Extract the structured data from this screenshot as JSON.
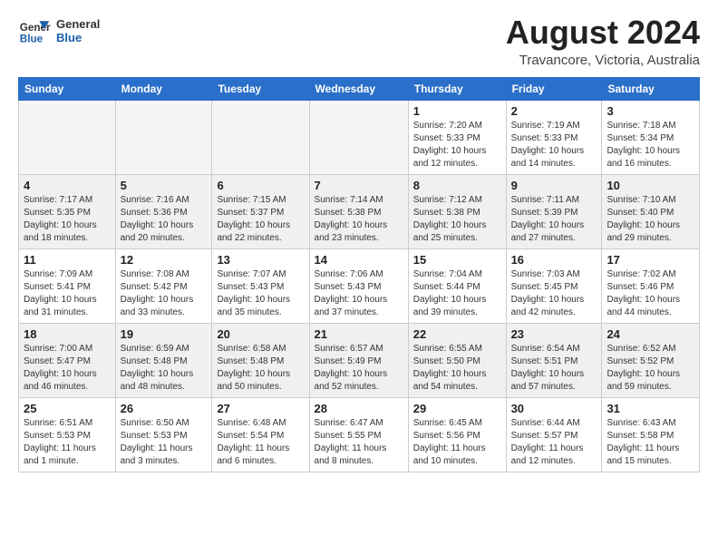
{
  "header": {
    "logo_general": "General",
    "logo_blue": "Blue",
    "month_title": "August 2024",
    "subtitle": "Travancore, Victoria, Australia"
  },
  "days_of_week": [
    "Sunday",
    "Monday",
    "Tuesday",
    "Wednesday",
    "Thursday",
    "Friday",
    "Saturday"
  ],
  "weeks": [
    [
      {
        "day": "",
        "info": ""
      },
      {
        "day": "",
        "info": ""
      },
      {
        "day": "",
        "info": ""
      },
      {
        "day": "",
        "info": ""
      },
      {
        "day": "1",
        "info": "Sunrise: 7:20 AM\nSunset: 5:33 PM\nDaylight: 10 hours\nand 12 minutes."
      },
      {
        "day": "2",
        "info": "Sunrise: 7:19 AM\nSunset: 5:33 PM\nDaylight: 10 hours\nand 14 minutes."
      },
      {
        "day": "3",
        "info": "Sunrise: 7:18 AM\nSunset: 5:34 PM\nDaylight: 10 hours\nand 16 minutes."
      }
    ],
    [
      {
        "day": "4",
        "info": "Sunrise: 7:17 AM\nSunset: 5:35 PM\nDaylight: 10 hours\nand 18 minutes."
      },
      {
        "day": "5",
        "info": "Sunrise: 7:16 AM\nSunset: 5:36 PM\nDaylight: 10 hours\nand 20 minutes."
      },
      {
        "day": "6",
        "info": "Sunrise: 7:15 AM\nSunset: 5:37 PM\nDaylight: 10 hours\nand 22 minutes."
      },
      {
        "day": "7",
        "info": "Sunrise: 7:14 AM\nSunset: 5:38 PM\nDaylight: 10 hours\nand 23 minutes."
      },
      {
        "day": "8",
        "info": "Sunrise: 7:12 AM\nSunset: 5:38 PM\nDaylight: 10 hours\nand 25 minutes."
      },
      {
        "day": "9",
        "info": "Sunrise: 7:11 AM\nSunset: 5:39 PM\nDaylight: 10 hours\nand 27 minutes."
      },
      {
        "day": "10",
        "info": "Sunrise: 7:10 AM\nSunset: 5:40 PM\nDaylight: 10 hours\nand 29 minutes."
      }
    ],
    [
      {
        "day": "11",
        "info": "Sunrise: 7:09 AM\nSunset: 5:41 PM\nDaylight: 10 hours\nand 31 minutes."
      },
      {
        "day": "12",
        "info": "Sunrise: 7:08 AM\nSunset: 5:42 PM\nDaylight: 10 hours\nand 33 minutes."
      },
      {
        "day": "13",
        "info": "Sunrise: 7:07 AM\nSunset: 5:43 PM\nDaylight: 10 hours\nand 35 minutes."
      },
      {
        "day": "14",
        "info": "Sunrise: 7:06 AM\nSunset: 5:43 PM\nDaylight: 10 hours\nand 37 minutes."
      },
      {
        "day": "15",
        "info": "Sunrise: 7:04 AM\nSunset: 5:44 PM\nDaylight: 10 hours\nand 39 minutes."
      },
      {
        "day": "16",
        "info": "Sunrise: 7:03 AM\nSunset: 5:45 PM\nDaylight: 10 hours\nand 42 minutes."
      },
      {
        "day": "17",
        "info": "Sunrise: 7:02 AM\nSunset: 5:46 PM\nDaylight: 10 hours\nand 44 minutes."
      }
    ],
    [
      {
        "day": "18",
        "info": "Sunrise: 7:00 AM\nSunset: 5:47 PM\nDaylight: 10 hours\nand 46 minutes."
      },
      {
        "day": "19",
        "info": "Sunrise: 6:59 AM\nSunset: 5:48 PM\nDaylight: 10 hours\nand 48 minutes."
      },
      {
        "day": "20",
        "info": "Sunrise: 6:58 AM\nSunset: 5:48 PM\nDaylight: 10 hours\nand 50 minutes."
      },
      {
        "day": "21",
        "info": "Sunrise: 6:57 AM\nSunset: 5:49 PM\nDaylight: 10 hours\nand 52 minutes."
      },
      {
        "day": "22",
        "info": "Sunrise: 6:55 AM\nSunset: 5:50 PM\nDaylight: 10 hours\nand 54 minutes."
      },
      {
        "day": "23",
        "info": "Sunrise: 6:54 AM\nSunset: 5:51 PM\nDaylight: 10 hours\nand 57 minutes."
      },
      {
        "day": "24",
        "info": "Sunrise: 6:52 AM\nSunset: 5:52 PM\nDaylight: 10 hours\nand 59 minutes."
      }
    ],
    [
      {
        "day": "25",
        "info": "Sunrise: 6:51 AM\nSunset: 5:53 PM\nDaylight: 11 hours\nand 1 minute."
      },
      {
        "day": "26",
        "info": "Sunrise: 6:50 AM\nSunset: 5:53 PM\nDaylight: 11 hours\nand 3 minutes."
      },
      {
        "day": "27",
        "info": "Sunrise: 6:48 AM\nSunset: 5:54 PM\nDaylight: 11 hours\nand 6 minutes."
      },
      {
        "day": "28",
        "info": "Sunrise: 6:47 AM\nSunset: 5:55 PM\nDaylight: 11 hours\nand 8 minutes."
      },
      {
        "day": "29",
        "info": "Sunrise: 6:45 AM\nSunset: 5:56 PM\nDaylight: 11 hours\nand 10 minutes."
      },
      {
        "day": "30",
        "info": "Sunrise: 6:44 AM\nSunset: 5:57 PM\nDaylight: 11 hours\nand 12 minutes."
      },
      {
        "day": "31",
        "info": "Sunrise: 6:43 AM\nSunset: 5:58 PM\nDaylight: 11 hours\nand 15 minutes."
      }
    ]
  ]
}
